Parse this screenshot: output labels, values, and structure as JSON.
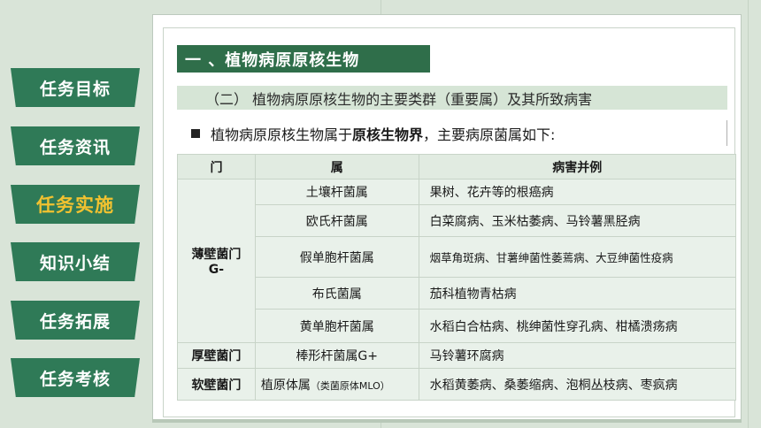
{
  "sidebar": {
    "items": [
      {
        "label": "任务目标"
      },
      {
        "label": "任务资讯"
      },
      {
        "label": "任务实施"
      },
      {
        "label": "知识小结"
      },
      {
        "label": "任务拓展"
      },
      {
        "label": "任务考核"
      }
    ],
    "active_index": 2,
    "button_color": "#2f7a57",
    "active_text_color": "#f2c230"
  },
  "section_title": "一 、植物病原原核生物",
  "subsection_title": "（二） 植物病原原核生物的主要类群（重要属）及其所致病害",
  "intro": {
    "before": "植物病原原核生物属于",
    "bold": "原核生物界",
    "after": "，主要病原菌属如下:"
  },
  "table": {
    "headers": [
      "门",
      "属",
      "病害并例"
    ],
    "groups": [
      {
        "phylum": "薄壁菌门",
        "phylum_sub": "G-",
        "rows": [
          {
            "genus": "土壤杆菌属",
            "diseases": "果树、花卉等的根癌病"
          },
          {
            "genus": "欧氏杆菌属",
            "diseases": "白菜腐病、玉米枯萎病、马铃薯黑胫病"
          },
          {
            "genus": "假单胞杆菌属",
            "diseases": "烟草角斑病、甘薯绅菌性萎蔫病、大豆绅菌性疫病"
          },
          {
            "genus": "布氏菌属",
            "diseases": "茄科植物青枯病"
          },
          {
            "genus": "黄单胞杆菌属",
            "diseases": "水稻白合枯病、桃绅菌性穿孔病、柑橘溃疡病"
          }
        ]
      },
      {
        "phylum": "厚壁菌门",
        "rows": [
          {
            "genus": "棒形杆菌属G+",
            "diseases": "马铃薯环腐病"
          }
        ]
      },
      {
        "phylum": "软壁菌门",
        "rows": [
          {
            "genus": "植原体属",
            "genus_note": "（类菌原体MLO）",
            "diseases": "水稻黄萎病、桑萎缩病、泡桐丛枝病、枣疯病"
          }
        ]
      }
    ]
  }
}
